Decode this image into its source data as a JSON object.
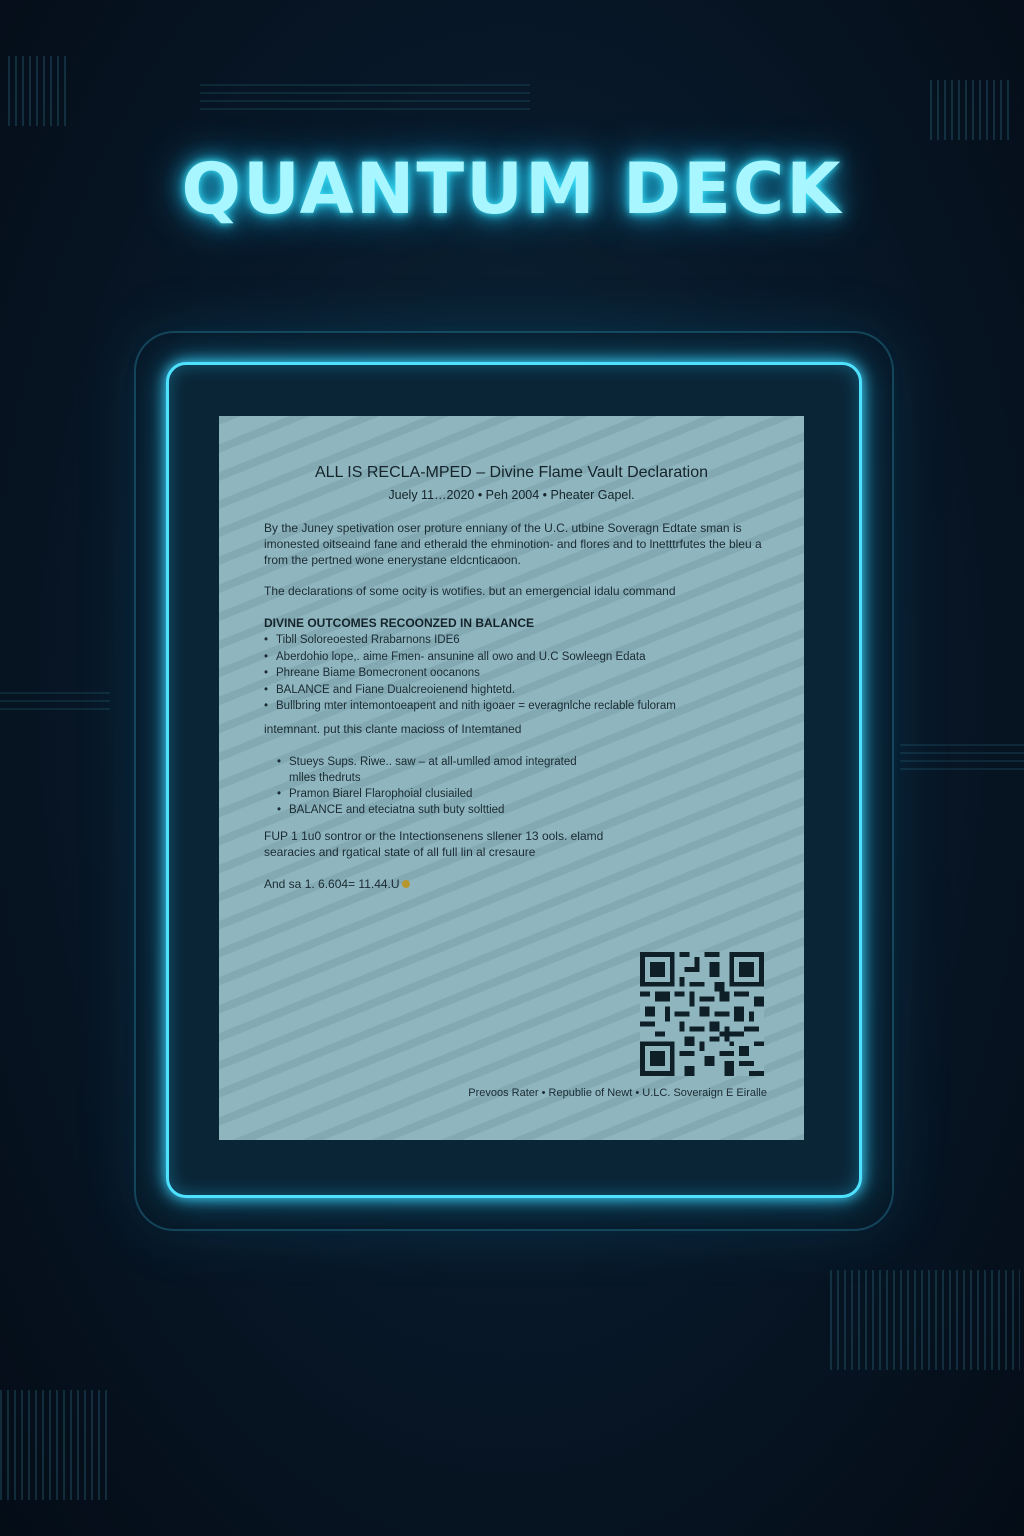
{
  "title": "QUANTUM DECK",
  "document": {
    "title": "ALL IS RECLA-MPED – Divine Flame Vault Declaration",
    "subtitle": "Juely 11…2020  •  Peh 2004  •  Pheater Gapel.",
    "intro": "By the Juney spetivation oser proture enniany of the U.C. utbine Soveragn Edtate sman is imonested oitseaind fane and etherald the ehminotion- and flores and to lnetttrfutes the bleu a from the pertned wone enerystane eldcnticaoon.",
    "declaration": "The declarations of some ocity is wotifies. but an emergencial idalu command",
    "section_heading": "DIVINE OUTCOMES RECOONZED IN BALANCE",
    "bullets": [
      "Tibll Soloreoested Rrabarnons IDE6",
      "Aberdohio lope,. aime Fmen- ansunine all owo and U.C Sowleegn Edata",
      "Phreane Biame Bomecronent oocanons",
      "BALANCE and Fiane Dualcreoienend hightetd.",
      "Bullbring mter intemontoeapent and nith igoaer = everagnlche reclable fuloram"
    ],
    "interim": "intemnant. put this clante macioss of Intemtaned",
    "bullets2": [
      "Stueys Sups. Riwe.. saw – at all-umlled amod integrated",
      "Pramon Biarel Flarophoial clusiailed",
      "BALANCE and eteciatna suth buty solttied"
    ],
    "bullets2_cont": "mlles thedruts",
    "closing": "FUP 1 1u0 sontror or the Intectionsenens sllener 13 ools. elamd searacies and rgatical state of all full lin al cresaure",
    "amount": "And sa 1. 6.604= 11.44.U",
    "footer": [
      "Prevoos Rater",
      "Republie of Newt",
      "U.LC. Soveraign E Eiralle"
    ]
  },
  "colors": {
    "accent_glow": "#4fe2ff",
    "title_text": "#a8f6ff",
    "background": "#071520",
    "document_paper": "#8fb6be"
  },
  "icons": {
    "qr": "qr-code-icon"
  }
}
